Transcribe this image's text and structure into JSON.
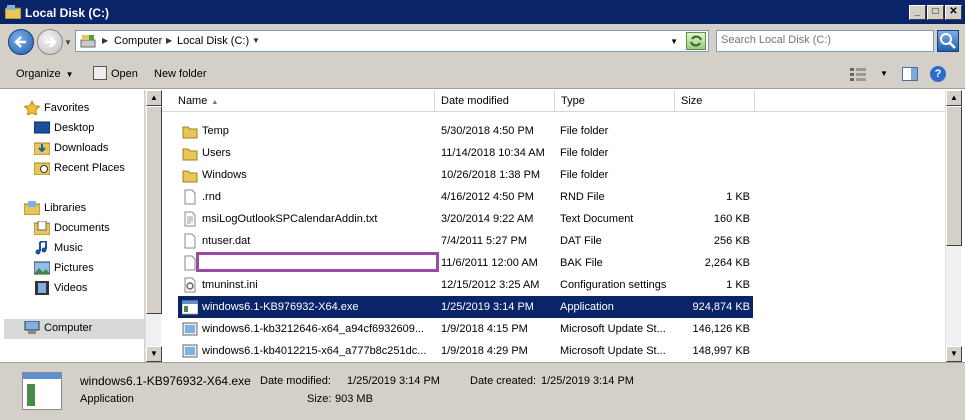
{
  "window": {
    "title": "Local Disk (C:)"
  },
  "window_buttons": {
    "minimize": "_",
    "maximize": "□",
    "close": "✕"
  },
  "address": {
    "crumbs": [
      "Computer",
      "Local Disk (C:)"
    ]
  },
  "search": {
    "placeholder": "Search Local Disk (C:)"
  },
  "toolbar": {
    "organize": "Organize",
    "open": "Open",
    "new_folder": "New folder"
  },
  "nav": {
    "favorites": "Favorites",
    "desktop": "Desktop",
    "downloads": "Downloads",
    "recent": "Recent Places",
    "libraries": "Libraries",
    "documents": "Documents",
    "music": "Music",
    "pictures": "Pictures",
    "videos": "Videos",
    "computer": "Computer"
  },
  "columns": {
    "name": "Name",
    "date": "Date modified",
    "type": "Type",
    "size": "Size"
  },
  "files": [
    {
      "name": "Temp",
      "date": "5/30/2018 4:50 PM",
      "type": "File folder",
      "size": "",
      "icon": "folder-icon"
    },
    {
      "name": "Users",
      "date": "11/14/2018 10:34 AM",
      "type": "File folder",
      "size": "",
      "icon": "folder-icon"
    },
    {
      "name": "Windows",
      "date": "10/26/2018 1:38 PM",
      "type": "File folder",
      "size": "",
      "icon": "folder-icon"
    },
    {
      "name": ".rnd",
      "date": "4/16/2012 4:50 PM",
      "type": "RND File",
      "size": "1 KB",
      "icon": "file-icon"
    },
    {
      "name": "msiLogOutlookSPCalendarAddin.txt",
      "date": "3/20/2014 9:22 AM",
      "type": "Text Document",
      "size": "160 KB",
      "icon": "text-file-icon"
    },
    {
      "name": "ntuser.dat",
      "date": "7/4/2011 5:27 PM",
      "type": "DAT File",
      "size": "256 KB",
      "icon": "file-icon"
    },
    {
      "name": "",
      "date": "11/6/2011 12:00 AM",
      "type": "BAK File",
      "size": "2,264 KB",
      "icon": "file-icon"
    },
    {
      "name": "tmuninst.ini",
      "date": "12/15/2012 3:25 AM",
      "type": "Configuration settings",
      "size": "1 KB",
      "icon": "config-file-icon"
    },
    {
      "name": "windows6.1-KB976932-X64.exe",
      "date": "1/25/2019 3:14 PM",
      "type": "Application",
      "size": "924,874 KB",
      "icon": "application-icon"
    },
    {
      "name": "windows6.1-kb3212646-x64_a94cf6932609...",
      "date": "1/9/2018 4:15 PM",
      "type": "Microsoft Update St...",
      "size": "146,126 KB",
      "icon": "update-package-icon"
    },
    {
      "name": "windows6.1-kb4012215-x64_a777b8c251dc...",
      "date": "1/9/2018 4:29 PM",
      "type": "Microsoft Update St...",
      "size": "148,997 KB",
      "icon": "update-package-icon"
    }
  ],
  "status": {
    "filename": "windows6.1-KB976932-X64.exe",
    "file_type": "Application",
    "date_modified_label": "Date modified:",
    "date_modified": "1/25/2019 3:14 PM",
    "date_created_label": "Date created:",
    "date_created": "1/25/2019 3:14 PM",
    "size_label": "Size:",
    "size": "903 MB"
  },
  "colors": {
    "title_bg": "#0a246a",
    "selection": "#0a246a",
    "chrome": "#d4d0c8",
    "redaction_border": "#9b4aa3"
  }
}
